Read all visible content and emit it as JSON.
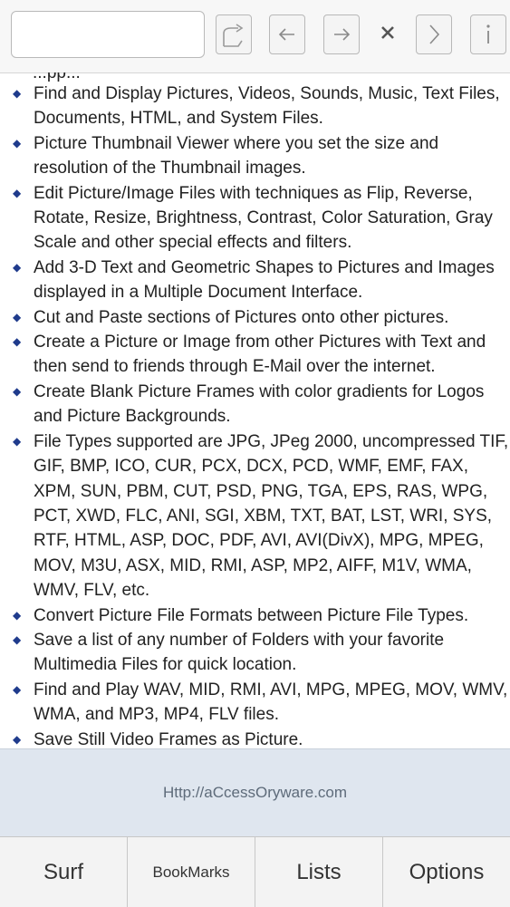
{
  "toolbar": {
    "url_value": "",
    "buttons": [
      {
        "name": "share-icon"
      },
      {
        "name": "back-arrow-icon"
      },
      {
        "name": "forward-arrow-icon"
      },
      {
        "name": "close-icon"
      },
      {
        "name": "chevron-right-icon"
      },
      {
        "name": "info-icon"
      }
    ]
  },
  "content": {
    "top_fragment": "...pp...",
    "features": [
      "Find and Display Pictures, Videos, Sounds, Music, Text Files, Documents, HTML, and System Files.",
      "Picture Thumbnail Viewer where you set the size and resolution of the Thumbnail images.",
      "Edit Picture/Image Files with techniques as Flip, Reverse, Rotate, Resize, Brightness, Contrast, Color Saturation, Gray Scale and other special effects and filters.",
      "Add 3-D Text and Geometric Shapes to Pictures and Images displayed in a Multiple Document Interface.",
      "Cut and Paste sections of Pictures onto other pictures.",
      "Create a Picture or Image from other Pictures with Text and then send to friends through E-Mail over the internet.",
      "Create Blank Picture Frames with color gradients for Logos and Picture Backgrounds.",
      "File Types supported are JPG, JPeg 2000, uncompressed TIF, GIF, BMP, ICO, CUR, PCX, DCX, PCD, WMF, EMF, FAX, XPM, SUN, PBM, CUT, PSD, PNG, TGA, EPS, RAS, WPG, PCT, XWD, FLC, ANI, SGI, XBM, TXT, BAT, LST, WRI, SYS, RTF, HTML, ASP, DOC, PDF, AVI, AVI(DivX), MPG, MPEG, MOV, M3U, ASX, MID, RMI, ASP, MP2, AIFF, M1V, WMA, WMV, FLV, etc.",
      "Convert Picture File Formats between Picture File Types.",
      "Save a list of any number of Folders with your favorite Multimedia Files for quick location.",
      "Find and Play WAV, MID, RMI, AVI, MPG, MPEG, MOV, WMV, WMA, and MP3, MP4, FLV files.",
      "Save Still Video Frames as Picture."
    ]
  },
  "footer": {
    "url_text": "Http://aCcessOryware.com",
    "tabs": [
      "Surf",
      "BookMarks",
      "Lists",
      "Options"
    ]
  },
  "colors": {
    "bullet": "#1f3b8c",
    "footer_bar": "#dfe6ef",
    "footer_text": "#5e6b7a"
  }
}
